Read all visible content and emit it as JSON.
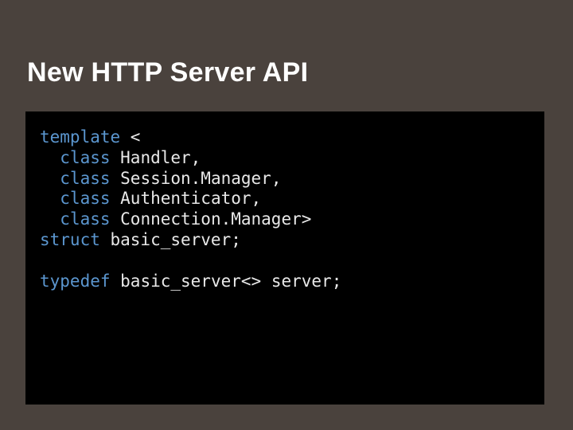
{
  "title": "New HTTP Server API",
  "code": {
    "kw_template": "template",
    "angle_open": " <",
    "kw_class": "class",
    "l1_id": " Handler",
    "l1_p": ",",
    "l2_id": " Session.Manager",
    "l2_p": ",",
    "l3_id": " Authenticator",
    "l3_p": ",",
    "l4_id": " Connection.Manager",
    "l4_p": ">",
    "kw_struct": "struct",
    "l5_id": " basic_server",
    "l5_p": ";",
    "kw_typedef": "typedef",
    "l7_id": " basic_server",
    "l7_mid": "<> ",
    "l7_id2": "server",
    "l7_p": ";"
  }
}
